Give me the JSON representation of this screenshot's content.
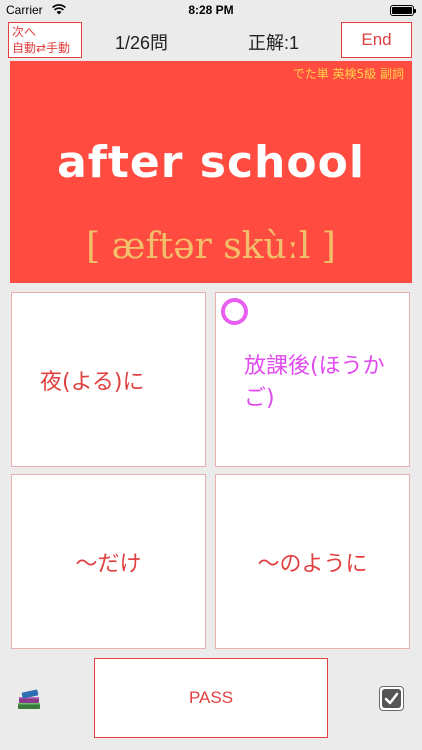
{
  "status_bar": {
    "carrier": "Carrier",
    "time": "8:28 PM",
    "battery_level": 1.0
  },
  "header": {
    "mode_toggle_line1": "次へ",
    "mode_toggle_line2": "自動⇄手動",
    "counter": "1/26問",
    "score": "正解:1",
    "end_label": "End"
  },
  "card": {
    "tag": "でた単 英検5級 副詞",
    "word": "after school",
    "phonetic": "[ æftər skùːl ]",
    "background_color": "#ff4b40"
  },
  "choices": [
    {
      "label": "夜(よる)に",
      "correct": false
    },
    {
      "label": "放課後(ほうかご)",
      "correct": true
    },
    {
      "label": "～だけ",
      "correct": false
    },
    {
      "label": "～のように",
      "correct": false
    }
  ],
  "footer": {
    "pass_label": "PASS",
    "left_icon": "books-icon",
    "right_icon": "checkbox-checked-icon"
  },
  "colors": {
    "accent": "#e04040",
    "correct": "#e04aee",
    "phonetic": "#f2c06a",
    "tag": "#ffd34a"
  }
}
